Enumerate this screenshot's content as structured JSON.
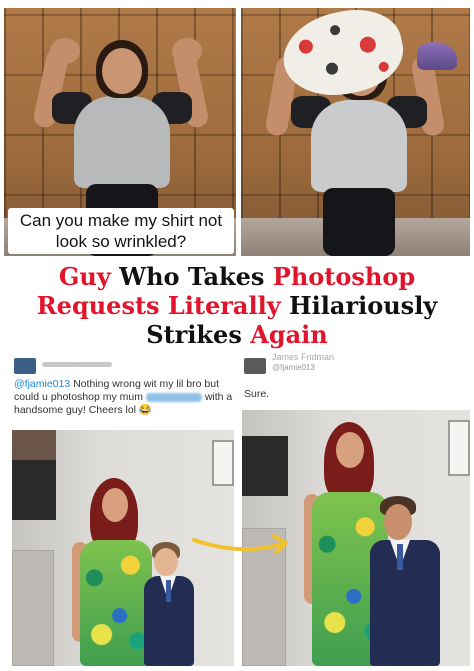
{
  "top_left": {
    "caption": "Can you make my shirt not look so wrinkled?"
  },
  "headline": {
    "line1_red": "Guy",
    "line1_black": " Who Takes ",
    "line1_red2": "Photoshop",
    "line2_red": "Requests Literally",
    "line2_black": " Hilariously",
    "line3_black": "Strikes ",
    "line3_red": "Again"
  },
  "tweet_request": {
    "handle": "@fjamie013",
    "text_1": " Nothing wrong wit my lil bro but could u photoshop my mum ",
    "text_2": " with a handsome guy! Cheers lol ",
    "emoji": "😂"
  },
  "tweet_reply": {
    "display_name": "James Fridman",
    "handle": "@fjamie013",
    "text": "Sure."
  },
  "colors": {
    "headline_red": "#e0142a",
    "arrow_yellow": "#f2c12e",
    "twitter_blue": "#1d8ad6"
  }
}
